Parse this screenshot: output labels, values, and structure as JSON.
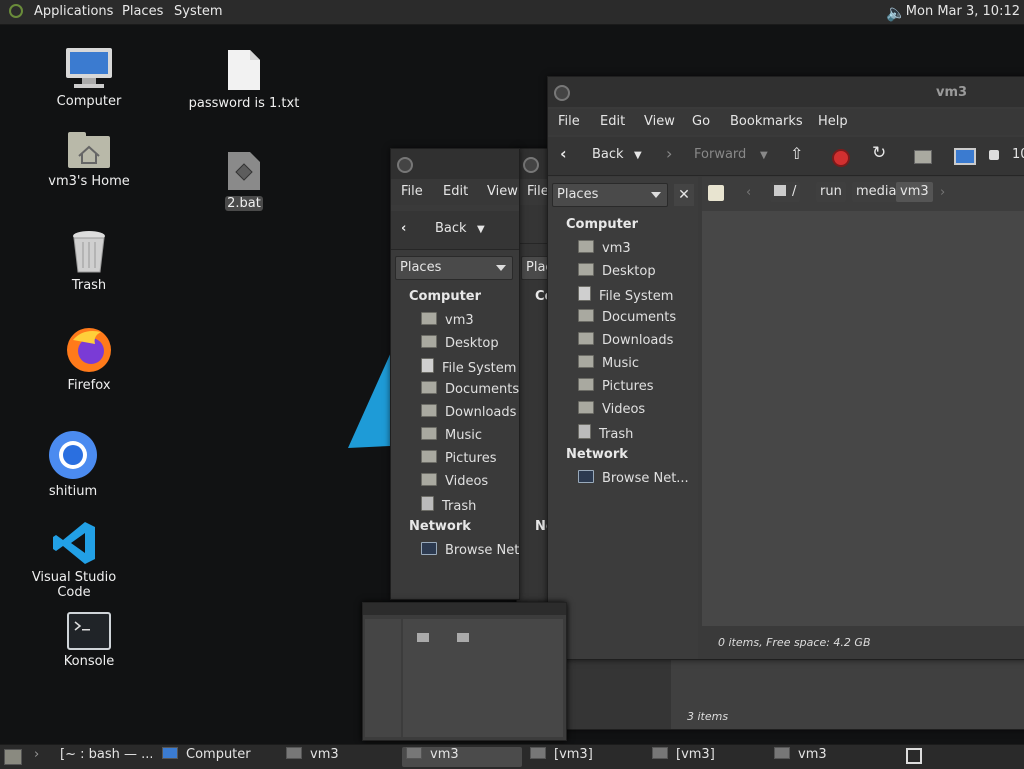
{
  "top_panel": {
    "menus": [
      "Applications",
      "Places",
      "System"
    ],
    "clock": "Mon Mar  3, 10:12"
  },
  "desktop_icons": [
    {
      "label": "Computer"
    },
    {
      "label": "vm3's Home"
    },
    {
      "label": "Trash"
    },
    {
      "label": "Firefox"
    },
    {
      "label": "shitium"
    },
    {
      "label": "Visual Studio Code"
    },
    {
      "label": "Konsole"
    },
    {
      "label": "password is 1.txt"
    },
    {
      "label": "2.bat"
    }
  ],
  "main_window": {
    "title": "vm3",
    "menus": [
      "File",
      "Edit",
      "View",
      "Go",
      "Bookmarks",
      "Help"
    ],
    "toolbar": {
      "back": "Back",
      "forward": "Forward",
      "zoom_partial": "10"
    },
    "places_label": "Places",
    "sections": {
      "computer": "Computer",
      "network": "Network"
    },
    "computer_items": [
      "vm3",
      "Desktop",
      "File System",
      "Documents",
      "Downloads",
      "Music",
      "Pictures",
      "Videos",
      "Trash"
    ],
    "network_items": [
      "Browse Net..."
    ],
    "path": [
      "/",
      "run",
      "media",
      "vm3"
    ],
    "status": "0 items, Free space: 4.2 GB"
  },
  "mid_window": {
    "menus": [
      "File",
      "Edit",
      "View"
    ],
    "toolbar": {
      "back": "Back"
    },
    "places_label": "Places",
    "sections": {
      "computer": "Computer",
      "network": "Network"
    },
    "computer_items": [
      "vm3",
      "Desktop",
      "File System",
      "Documents",
      "Downloads",
      "Music",
      "Pictures",
      "Videos",
      "Trash"
    ],
    "network_items": [
      "Browse Net."
    ]
  },
  "back_window": {
    "menus": [
      "File"
    ],
    "places_label": "Plac",
    "section_partial": "Co",
    "network_partial": "Ne",
    "status": "3 items"
  },
  "taskbar": {
    "items": [
      "[~ : bash — ...",
      "Computer",
      "vm3",
      "vm3",
      "[vm3]",
      "[vm3]",
      "vm3"
    ]
  },
  "colors": {
    "accent_blue": "#1e9bd7",
    "panel": "#2b2b2b",
    "window": "#3a3a3a"
  }
}
